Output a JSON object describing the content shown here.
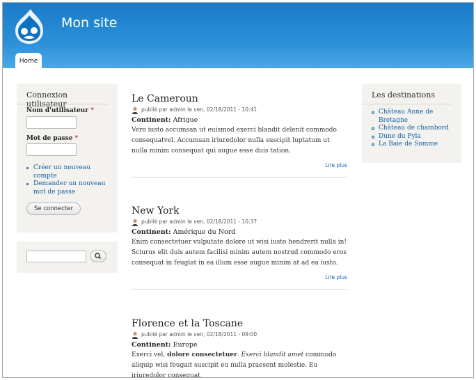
{
  "site": {
    "name": "Mon site"
  },
  "nav": {
    "tabs": [
      {
        "label": "Home"
      }
    ]
  },
  "login": {
    "title": "Connexion utilisateur",
    "username_label": "Nom d'utilisateur",
    "password_label": "Mot de passe",
    "required_mark": "*",
    "links": [
      "Créer un nouveau compte",
      "Demander un nouveau mot de passe"
    ],
    "submit_label": "Se connecter"
  },
  "search": {
    "button_icon": "search-icon"
  },
  "destinations": {
    "title": "Les destinations",
    "items": [
      "Château Anne de Bretagne",
      "Château de chambord",
      "Dune du Pyla",
      "La Baie de Somme"
    ]
  },
  "articles": [
    {
      "title": "Le Cameroun",
      "meta": "publié par admin le ven, 02/18/2011 - 10:41",
      "field_label": "Continent:",
      "field_value": "Afrique",
      "body": "Vero iusto accumsan ut euismod exerci blandit delenit commodo consequatvel. Accumsan iriuredolor nulla suscipit luptatum ut nulla minim consequat qui augue esse duis tation.",
      "read_more": "Lire plus"
    },
    {
      "title": "New York",
      "meta": "publié par admin le ven, 02/18/2011 - 10:37",
      "field_label": "Continent:",
      "field_value": "Amérique du Nord",
      "body": "Enim consectetuer vulputate dolore ut wisi iusto hendrerit nulla in! Sciurus elit duis autem facilisi minim autem nostrud commodo eros consequat in feugiat in ea illum esse augue minim at ad ea iusto.",
      "read_more": "Lire plus"
    },
    {
      "title": "Florence et la Toscane",
      "meta": "publié par admin le ven, 02/18/2011 - 09:00",
      "field_label": "Continent:",
      "field_value": "Europe",
      "body_parts": {
        "p1": "Exerci vel, ",
        "bold": "dolore consectetuer",
        "p2": ". ",
        "italic": "Exerci blandit amet",
        "p3": " commodo aliquip wisi feugait suscipit eu nulla praesent molestie. Eu iriuredolor consequat"
      }
    }
  ],
  "colors": {
    "header": "#1a7bc8",
    "link": "#0b5fa8",
    "sidebar_bg": "#f3f2ee"
  }
}
